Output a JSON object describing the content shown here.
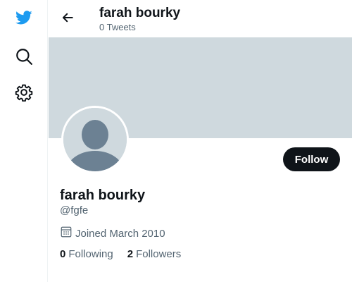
{
  "header": {
    "name": "farah bourky",
    "tweets_count": "0 Tweets"
  },
  "profile": {
    "display_name": "farah bourky",
    "handle": "@fgfe",
    "joined": "Joined March 2010",
    "following_count": "0",
    "following_label": "Following",
    "followers_count": "2",
    "followers_label": "Followers"
  },
  "actions": {
    "follow_label": "Follow"
  },
  "icons": {
    "logo": "twitter-bird-icon",
    "explore": "search-icon",
    "settings": "gear-icon",
    "back": "arrow-left-icon",
    "calendar": "calendar-icon"
  },
  "colors": {
    "brand": "#1d9bf0",
    "banner": "#cfd9de",
    "text_primary": "#0f1419",
    "text_secondary": "#536471",
    "button_dark": "#0f1419"
  }
}
